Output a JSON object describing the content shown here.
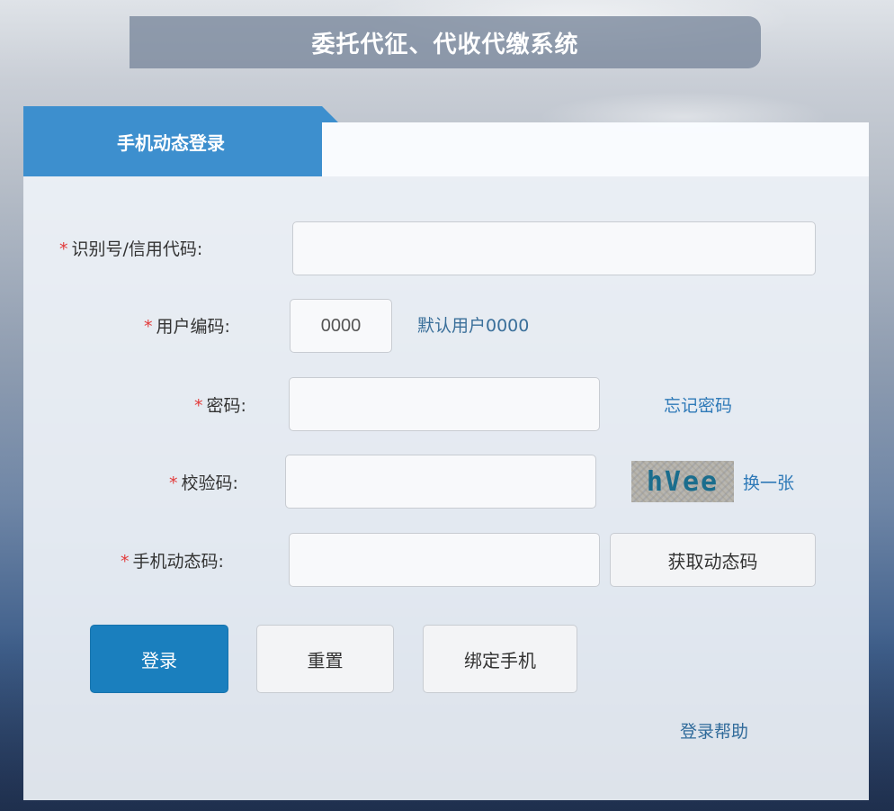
{
  "header": {
    "title": "委托代征、代收代缴系统"
  },
  "tabs": {
    "active_label": "手机动态登录"
  },
  "form": {
    "required_mark": "*",
    "taxpayer_id": {
      "label": "识别号/信用代码:",
      "value": "",
      "placeholder": ""
    },
    "user_code": {
      "label": "用户编码:",
      "value": "0000",
      "hint": "默认用户0000"
    },
    "password": {
      "label": "密码:",
      "value": "",
      "forgot_link": "忘记密码"
    },
    "captcha": {
      "label": "校验码:",
      "value": "",
      "image_text": "hVee",
      "refresh_link": "换一张"
    },
    "sms_code": {
      "label": "手机动态码:",
      "value": "",
      "get_code_button": "获取动态码"
    }
  },
  "actions": {
    "login": "登录",
    "reset": "重置",
    "bind_phone": "绑定手机",
    "help_link": "登录帮助"
  },
  "colors": {
    "accent": "#3d8fce",
    "primary_button": "#1a7fbe",
    "link": "#2f7ab8",
    "required": "#e23b3b"
  }
}
